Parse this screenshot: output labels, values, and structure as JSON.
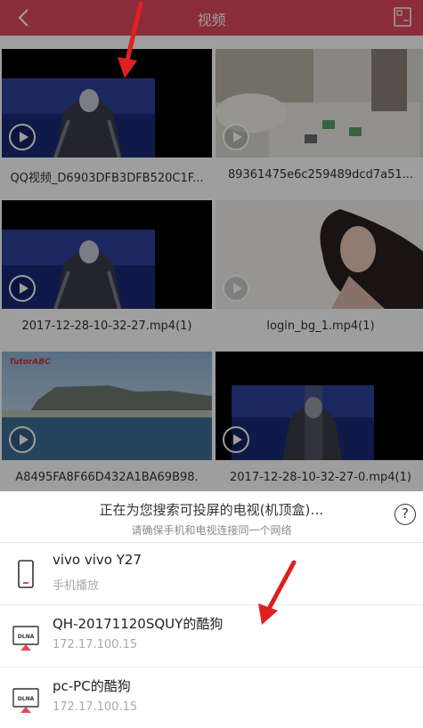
{
  "header": {
    "title": "视频"
  },
  "videos": [
    {
      "name": "QQ视频_D6903DFB3DFB520C1F..."
    },
    {
      "name": "89361475e6c259489dcd7a51..."
    },
    {
      "name": "2017-12-28-10-32-27.mp4(1)"
    },
    {
      "name": "login_bg_1.mp4(1)"
    },
    {
      "name": "A8495FA8F66D432A1BA69B98."
    },
    {
      "name": "2017-12-28-10-32-27-0.mp4(1)"
    }
  ],
  "thumb_watermark": "TutorABC",
  "sheet": {
    "title": "正在为您搜索可投屏的电视(机顶盒)…",
    "subtitle": "请确保手机和电视连接同一个网络",
    "help": "?"
  },
  "devices": [
    {
      "name": "vivo vivo Y27",
      "sub": "手机播放",
      "icon": "phone-icon"
    },
    {
      "name": "QH-20171120SQUY的酷狗",
      "sub": "172.17.100.15",
      "icon": "dlna-tv-icon",
      "icon_label": "DLNA"
    },
    {
      "name": "pc-PC的酷狗",
      "sub": "172.17.100.15",
      "icon": "dlna-tv-icon",
      "icon_label": "DLNA"
    }
  ],
  "colors": {
    "topbar": "#e0485e",
    "arrow": "#e02020",
    "dlna": "#e0485e"
  }
}
